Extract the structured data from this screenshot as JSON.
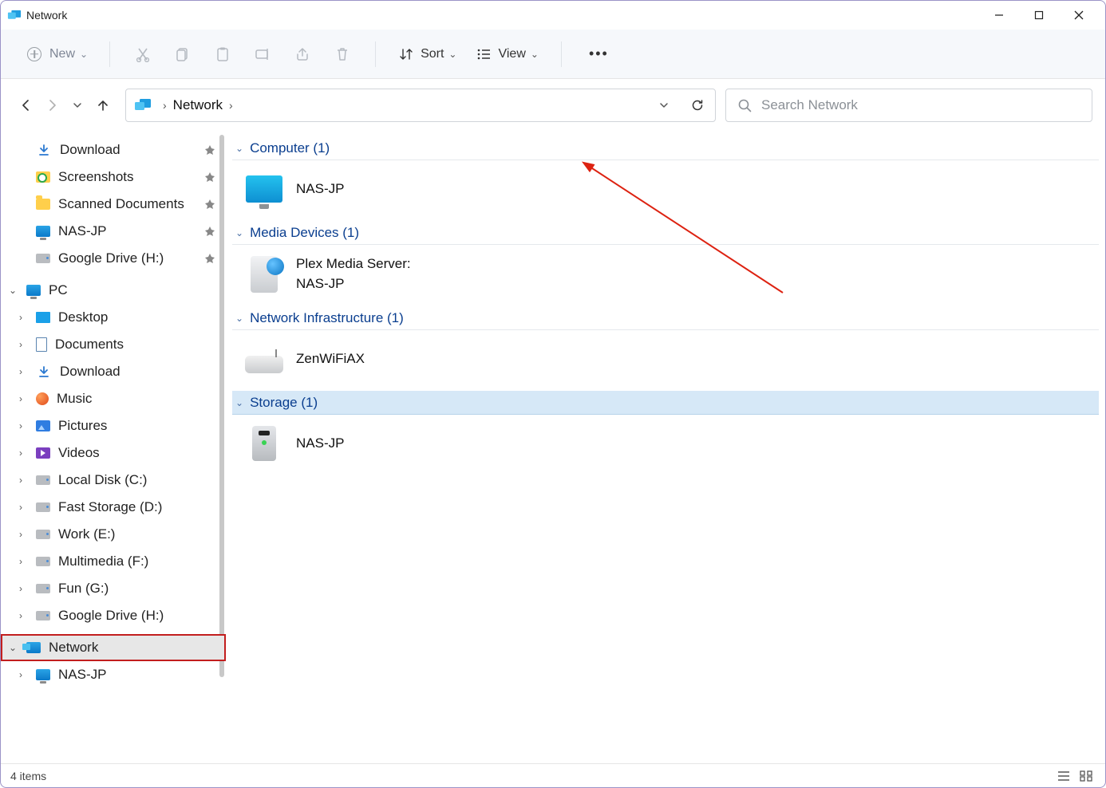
{
  "window": {
    "title": "Network"
  },
  "toolbar": {
    "new_label": "New",
    "sort_label": "Sort",
    "view_label": "View"
  },
  "address": {
    "location": "Network"
  },
  "search": {
    "placeholder": "Search Network"
  },
  "sidebar": {
    "quick": [
      {
        "label": "Download",
        "icon": "download",
        "pinned": true
      },
      {
        "label": "Screenshots",
        "icon": "shot",
        "pinned": true
      },
      {
        "label": "Scanned Documents",
        "icon": "folder",
        "pinned": true
      },
      {
        "label": "NAS-JP",
        "icon": "monitor",
        "pinned": true
      },
      {
        "label": "Google Drive (H:)",
        "icon": "drive",
        "pinned": true
      }
    ],
    "pc_label": "PC",
    "pc_children": [
      {
        "label": "Desktop",
        "icon": "desk"
      },
      {
        "label": "Documents",
        "icon": "doc"
      },
      {
        "label": "Download",
        "icon": "download"
      },
      {
        "label": "Music",
        "icon": "music"
      },
      {
        "label": "Pictures",
        "icon": "pic"
      },
      {
        "label": "Videos",
        "icon": "vid"
      },
      {
        "label": "Local Disk (C:)",
        "icon": "drive"
      },
      {
        "label": "Fast Storage (D:)",
        "icon": "drive"
      },
      {
        "label": "Work (E:)",
        "icon": "drive"
      },
      {
        "label": "Multimedia (F:)",
        "icon": "drive"
      },
      {
        "label": "Fun (G:)",
        "icon": "drive"
      },
      {
        "label": "Google Drive (H:)",
        "icon": "drive"
      }
    ],
    "network_label": "Network",
    "network_children": [
      {
        "label": "NAS-JP",
        "icon": "monitor"
      }
    ]
  },
  "content": {
    "groups": [
      {
        "key": "computer",
        "header": "Computer (1)",
        "items": [
          {
            "label_line1": "NAS-JP",
            "label_line2": "",
            "icon": "big-monitor"
          }
        ]
      },
      {
        "key": "media",
        "header": "Media Devices (1)",
        "items": [
          {
            "label_line1": "Plex Media Server:",
            "label_line2": "NAS-JP",
            "icon": "big-media"
          }
        ]
      },
      {
        "key": "infra",
        "header": "Network Infrastructure (1)",
        "items": [
          {
            "label_line1": "ZenWiFiAX",
            "label_line2": "",
            "icon": "big-router"
          }
        ]
      },
      {
        "key": "storage",
        "header": "Storage (1)",
        "selected": true,
        "items": [
          {
            "label_line1": "NAS-JP",
            "label_line2": "",
            "icon": "big-tower"
          }
        ]
      }
    ]
  },
  "status": {
    "text": "4 items"
  }
}
